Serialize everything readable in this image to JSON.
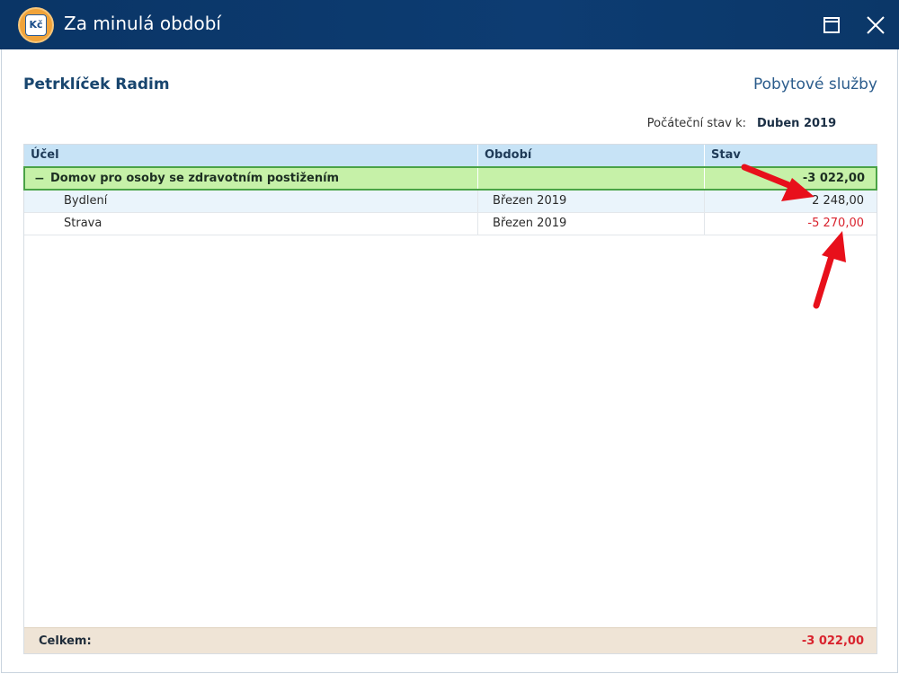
{
  "window": {
    "title": "Za minulá období",
    "icon": "kc-wallet-icon",
    "icon_text": "Kč"
  },
  "header": {
    "person_name": "Petrklíček Radim",
    "service_name": "Pobytové služby",
    "state_label": "Počáteční stav k:",
    "state_value": "Duben 2019"
  },
  "grid": {
    "columns": [
      "Účel",
      "Období",
      "Stav"
    ],
    "group": {
      "toggle": "−",
      "label": "Domov pro osoby se zdravotním postižením",
      "value": "-3 022,00"
    },
    "rows": [
      {
        "purpose": "Bydlení",
        "period": "Březen 2019",
        "value": "2 248,00"
      },
      {
        "purpose": "Strava",
        "period": "Březen 2019",
        "value": "-5 270,00"
      }
    ],
    "footer": {
      "label": "Celkem:",
      "value": "-3 022,00"
    }
  },
  "colors": {
    "titlebar": "#0d3c72",
    "group_row": "#c6f1a8",
    "negative": "#d9232e",
    "annotation_arrow": "#e8101b"
  }
}
